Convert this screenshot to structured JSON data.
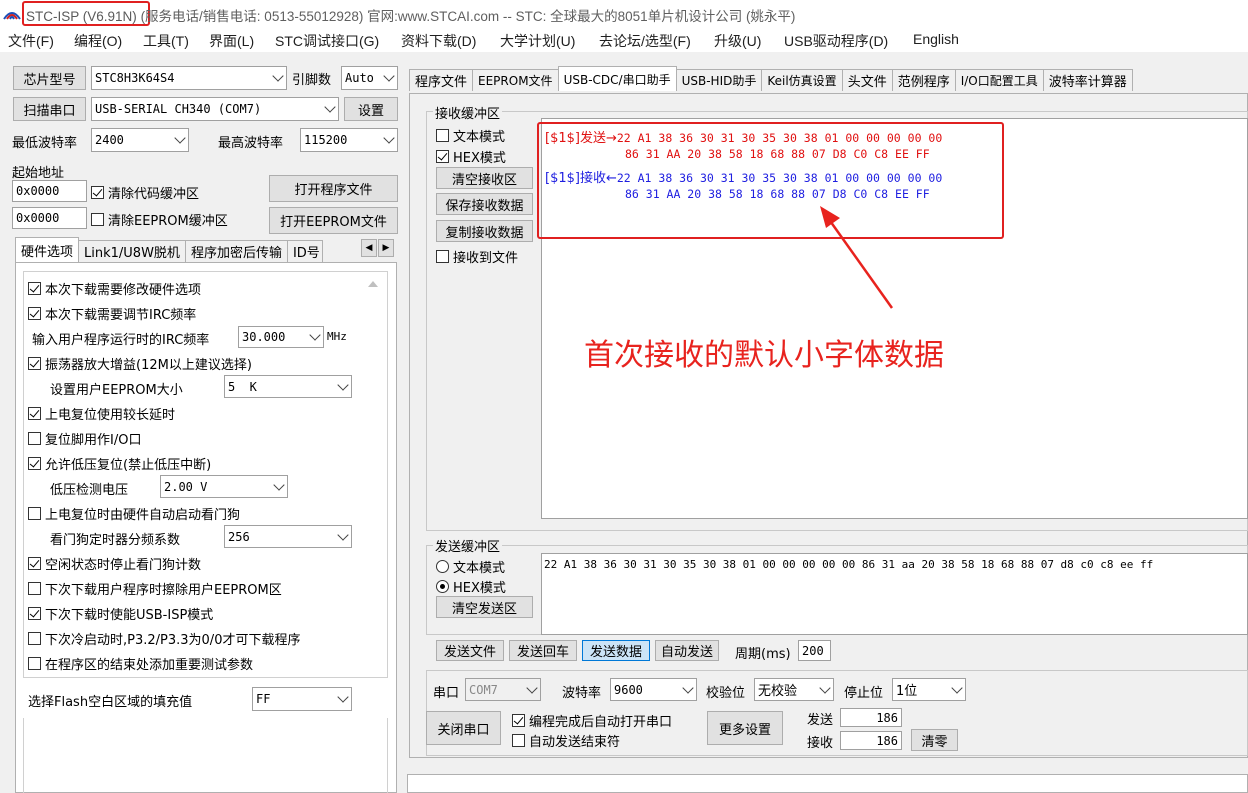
{
  "window": {
    "title_app": "STC-ISP (V6.91N)",
    "title_rest": "(服务电话/销售电话: 0513-55012928) 官网:www.STCAI.com  -- STC: 全球最大的8051单片机设计公司 (姚永平)"
  },
  "menu": [
    "文件(F)",
    "编程(O)",
    "工具(T)",
    "界面(L)",
    "STC调试接口(G)",
    "资料下载(D)",
    "大学计划(U)",
    "去论坛/选型(F)",
    "升级(U)",
    "USB驱动程序(D)",
    "English"
  ],
  "left": {
    "chip_button": "芯片型号",
    "chip_value": "STC8H3K64S4",
    "pins_label": "引脚数",
    "pins_value": "Auto",
    "scan_button": "扫描串口",
    "port_value": "USB-SERIAL CH340 (COM7)",
    "settings_button": "设置",
    "min_baud_label": "最低波特率",
    "min_baud_value": "2400",
    "max_baud_label": "最高波特率",
    "max_baud_value": "115200",
    "start_addr_label": "起始地址",
    "addr1_value": "0x0000",
    "clear_code_label": "清除代码缓冲区",
    "open_program_button": "打开程序文件",
    "addr2_value": "0x0000",
    "clear_eeprom_label": "清除EEPROM缓冲区",
    "open_eeprom_button": "打开EEPROM文件",
    "tabs": [
      "硬件选项",
      "Link1/U8W脱机",
      "程序加密后传输",
      "ID号"
    ],
    "options": {
      "opt1": "本次下载需要修改硬件选项",
      "opt2": "本次下载需要调节IRC频率",
      "irc_label": "输入用户程序运行时的IRC频率",
      "irc_value": "30.000",
      "irc_unit": "MHz",
      "opt3": "振荡器放大增益(12M以上建议选择)",
      "eeprom_size_label": "设置用户EEPROM大小",
      "eeprom_size_value": "5  K",
      "opt4": "上电复位使用较长延时",
      "opt5": "复位脚用作I/O口",
      "opt6": "允许低压复位(禁止低压中断)",
      "lv_label": "低压检测电压",
      "lv_value": "2.00 V",
      "opt7": "上电复位时由硬件自动启动看门狗",
      "wdt_label": "看门狗定时器分频系数",
      "wdt_value": "256",
      "opt8": "空闲状态时停止看门狗计数",
      "opt9": "下次下载用户程序时擦除用户EEPROM区",
      "opt10": "下次下载时使能USB-ISP模式",
      "opt11": "下次冷启动时,P3.2/P3.3为0/0才可下载程序",
      "opt12": "在程序区的结束处添加重要测试参数",
      "flash_fill_label": "选择Flash空白区域的填充值",
      "flash_fill_value": "FF"
    }
  },
  "right": {
    "tabs": [
      "程序文件",
      "EEPROM文件",
      "USB-CDC/串口助手",
      "USB-HID助手",
      "Keil仿真设置",
      "头文件",
      "范例程序",
      "I/O口配置工具",
      "波特率计算器"
    ],
    "recv": {
      "title": "接收缓冲区",
      "text_mode": "文本模式",
      "hex_mode": "HEX模式",
      "clear_button": "清空接收区",
      "save_button": "保存接收数据",
      "copy_button": "复制接收数据",
      "to_file": "接收到文件",
      "lines": [
        {
          "prefix": "[$1$]发送→",
          "data": "22 A1 38 36 30 31 30 35 30 38 01 00 00 00 00 00"
        },
        {
          "prefix": "",
          "data": "86 31 AA 20 38 58 18 68 88 07 D8 C0 C8 EE FF"
        },
        {
          "prefix": "[$1$]接收←",
          "data": "22 A1 38 36 30 31 30 35 30 38 01 00 00 00 00 00"
        },
        {
          "prefix": "",
          "data": "86 31 AA 20 38 58 18 68 88 07 D8 C0 C8 EE FF"
        }
      ]
    },
    "annotation": "首次接收的默认小字体数据",
    "send": {
      "title": "发送缓冲区",
      "text_mode": "文本模式",
      "hex_mode": "HEX模式",
      "clear_button": "清空发送区",
      "data": "22 A1 38 36 30 31 30 35 30 38 01 00 00 00 00 00 86 31 aa 20 38 58 18 68 88 07 d8 c0 c8 ee ff"
    },
    "actions": {
      "send_file": "发送文件",
      "send_back": "发送回车",
      "send_data": "发送数据",
      "auto_send": "自动发送",
      "period_label": "周期(ms)",
      "period_value": "200"
    },
    "serial": {
      "port_label": "串口",
      "port_value": "COM7",
      "baud_label": "波特率",
      "baud_value": "9600",
      "parity_label": "校验位",
      "parity_value": "无校验",
      "stop_label": "停止位",
      "stop_value": "1位",
      "close_button": "关闭串口",
      "auto_open": "编程完成后自动打开串口",
      "auto_end": "自动发送结束符",
      "more_button": "更多设置",
      "sent_label": "发送",
      "sent_value": "186",
      "recv_label": "接收",
      "recv_value": "186",
      "clear_button": "清零"
    }
  },
  "colors": {
    "annotation": "#e8231e",
    "send_text": "#e01010",
    "recv_text": "#1e1ee0"
  }
}
